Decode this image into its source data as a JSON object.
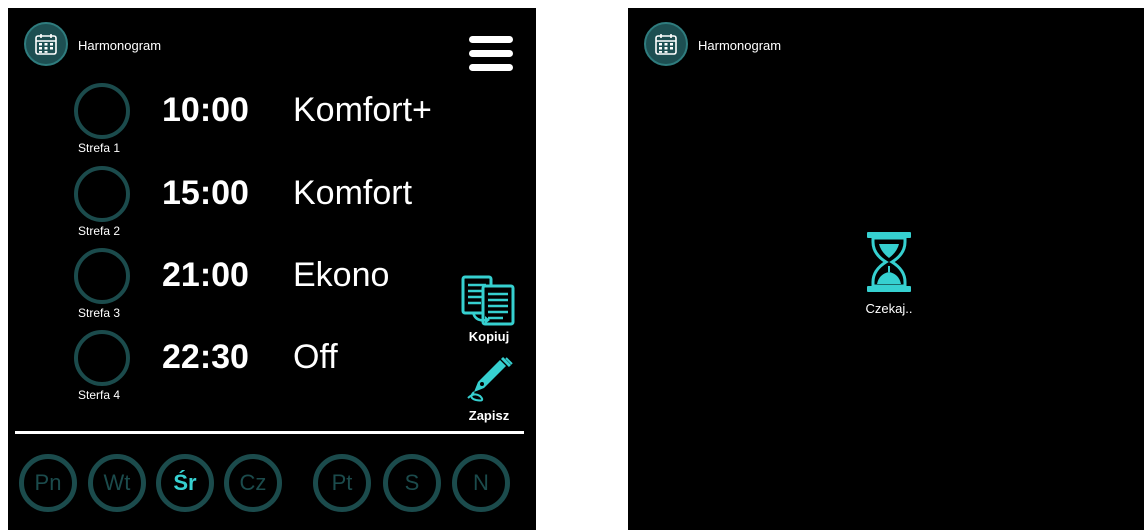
{
  "colors": {
    "accent": "#36d0d0",
    "ring": "#1b4b4c",
    "background": "#000000"
  },
  "left": {
    "header": {
      "title": "Harmonogram",
      "icon": "calendar-icon"
    },
    "menu_icon": "hamburger-menu-icon",
    "zones": [
      {
        "label": "Strefa 1",
        "time": "10:00",
        "mode": "Komfort+"
      },
      {
        "label": "Strefa 2",
        "time": "15:00",
        "mode": "Komfort"
      },
      {
        "label": "Strefa 3",
        "time": "21:00",
        "mode": "Ekono"
      },
      {
        "label": "Sterfa 4",
        "time": "22:30",
        "mode": "Off"
      }
    ],
    "copy_button": {
      "label": "Kopiuj",
      "icon": "copy-documents-icon"
    },
    "save_button": {
      "label": "Zapisz",
      "icon": "pen-nib-icon"
    },
    "days": [
      {
        "label": "Pn",
        "active": false
      },
      {
        "label": "Wt",
        "active": false
      },
      {
        "label": "Śr",
        "active": true
      },
      {
        "label": "Cz",
        "active": false
      },
      {
        "label": "Pt",
        "active": false
      },
      {
        "label": "S",
        "active": false
      },
      {
        "label": "N",
        "active": false
      }
    ]
  },
  "right": {
    "header": {
      "title": "Harmonogram",
      "icon": "calendar-icon"
    },
    "loading": {
      "label": "Czekaj..",
      "icon": "hourglass-icon"
    }
  }
}
